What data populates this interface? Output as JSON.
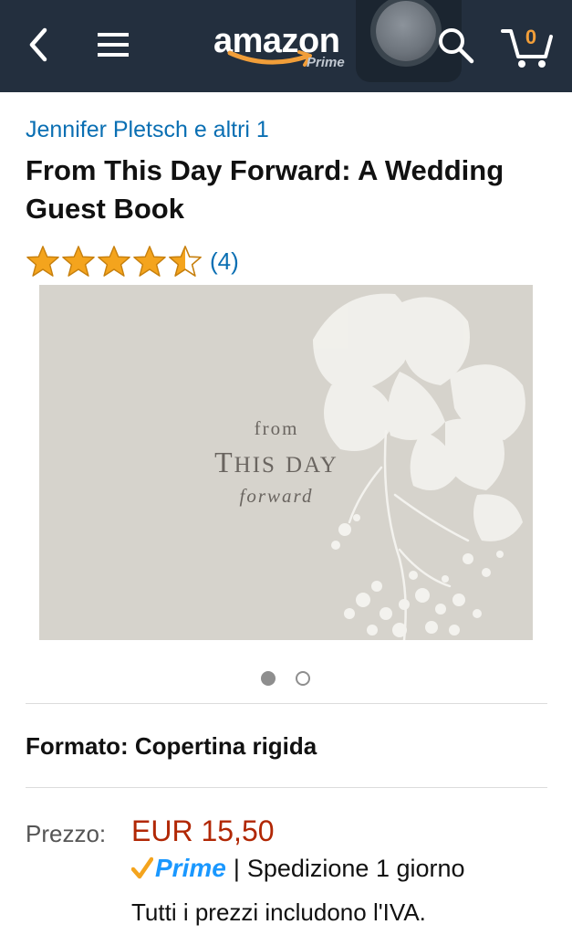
{
  "header": {
    "back_icon": "chevron-left-icon",
    "menu_icon": "hamburger-menu-icon",
    "logo_text": "amazon",
    "logo_subtext": "Prime",
    "search_icon": "search-icon",
    "cart_icon": "cart-icon",
    "cart_count": "0",
    "background_color": "#232f3e",
    "cart_count_color": "#f19e39"
  },
  "product": {
    "author": "Jennifer Pletsch e altri 1",
    "title": "From This Day Forward: A Wedding Guest Book",
    "rating": 4.5,
    "rating_count": "(4)",
    "cover": {
      "line1": "from",
      "line2_initial_t": "T",
      "line2_rest_his": "HIS",
      "line2_initial_d": "D",
      "line2_rest_ay": "AY",
      "line3": "forward"
    },
    "image_pages": {
      "total": 2,
      "active": 1
    },
    "format": "Formato: Copertina rigida",
    "price_label": "Prezzo:",
    "price": "EUR 15,50",
    "prime_label": "Prime",
    "shipping_separator": "|",
    "shipping": "Spedizione 1 giorno",
    "vat_note": "Tutti i prezzi includono l'IVA."
  },
  "colors": {
    "link": "#0a6fb3",
    "price": "#b12704",
    "star": "#f4a41d",
    "prime": "#1a98ff"
  }
}
